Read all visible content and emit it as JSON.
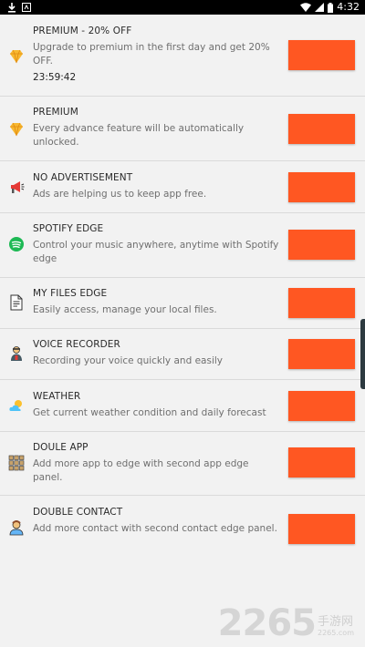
{
  "statusbar": {
    "time": "4:32"
  },
  "items": [
    {
      "title": "PREMIUM - 20% OFF",
      "desc": "Upgrade to premium in the first day and get 20% OFF.",
      "timer": "23:59:42",
      "icon": "diamond-icon"
    },
    {
      "title": "PREMIUM",
      "desc": "Every advance feature will be automatically unlocked.",
      "icon": "diamond-icon"
    },
    {
      "title": "NO ADVERTISEMENT",
      "desc": "Ads are helping us to keep app free.",
      "icon": "megaphone-icon"
    },
    {
      "title": "SPOTIFY EDGE",
      "desc": "Control your music anywhere, anytime with Spotify edge",
      "icon": "spotify-icon"
    },
    {
      "title": "MY FILES EDGE",
      "desc": "Easily access, manage your local files.",
      "icon": "file-icon"
    },
    {
      "title": "VOICE RECORDER",
      "desc": "Recording your voice quickly and easily",
      "icon": "recorder-icon"
    },
    {
      "title": "WEATHER",
      "desc": "Get current weather condition and daily forecast",
      "icon": "weather-icon"
    },
    {
      "title": "DOULE APP",
      "desc": "Add more app to edge with second app edge panel.",
      "icon": "app-grid-icon"
    },
    {
      "title": "DOUBLE CONTACT",
      "desc": "Add more contact with second contact edge panel.",
      "icon": "contact-icon"
    }
  ],
  "watermark": {
    "number": "2265",
    "label": "手游网",
    "url": "2265.com"
  },
  "colors": {
    "button": "#ff5722",
    "background": "#f2f2f2"
  }
}
